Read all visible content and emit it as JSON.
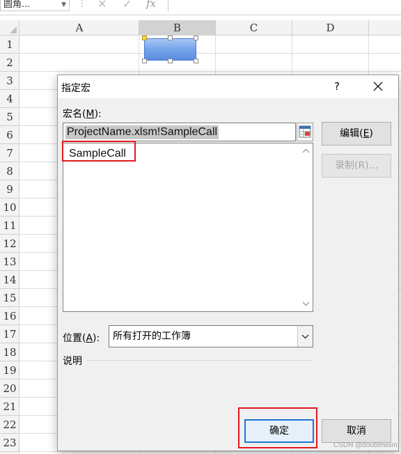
{
  "formula_bar": {
    "name_box": "圆角...",
    "separator": "⋮",
    "cancel_glyph": "✕",
    "enter_glyph": "✓",
    "fx_glyph": "fx"
  },
  "sheet": {
    "columns": [
      "A",
      "B",
      "C",
      "D"
    ],
    "selected_column": "B",
    "rows": [
      "1",
      "2",
      "3",
      "4",
      "5",
      "6",
      "7",
      "8",
      "9",
      "10",
      "11",
      "12",
      "13",
      "14",
      "15",
      "16",
      "17",
      "18",
      "19",
      "20",
      "21",
      "22",
      "23"
    ]
  },
  "dialog": {
    "title": "指定宏",
    "help_glyph": "?",
    "macro_name_label_pre": "宏名(",
    "macro_name_label_key": "M",
    "macro_name_label_post": "):",
    "macro_name_value": "ProjectName.xlsm!SampleCall",
    "macro_list": [
      "SampleCall"
    ],
    "location_label_pre": "位置(",
    "location_label_key": "A",
    "location_label_post": "):",
    "location_value": "所有打开的工作簿",
    "description_label": "说明",
    "edit_button_pre": "编辑(",
    "edit_button_key": "E",
    "edit_button_post": ")",
    "record_button": "录制(R)...",
    "ok_button": "确定",
    "cancel_button": "取消"
  },
  "watermark": "CSDN @doublewsm",
  "colors": {
    "highlight_red": "#e0191f",
    "ok_border": "#1f74d3"
  }
}
